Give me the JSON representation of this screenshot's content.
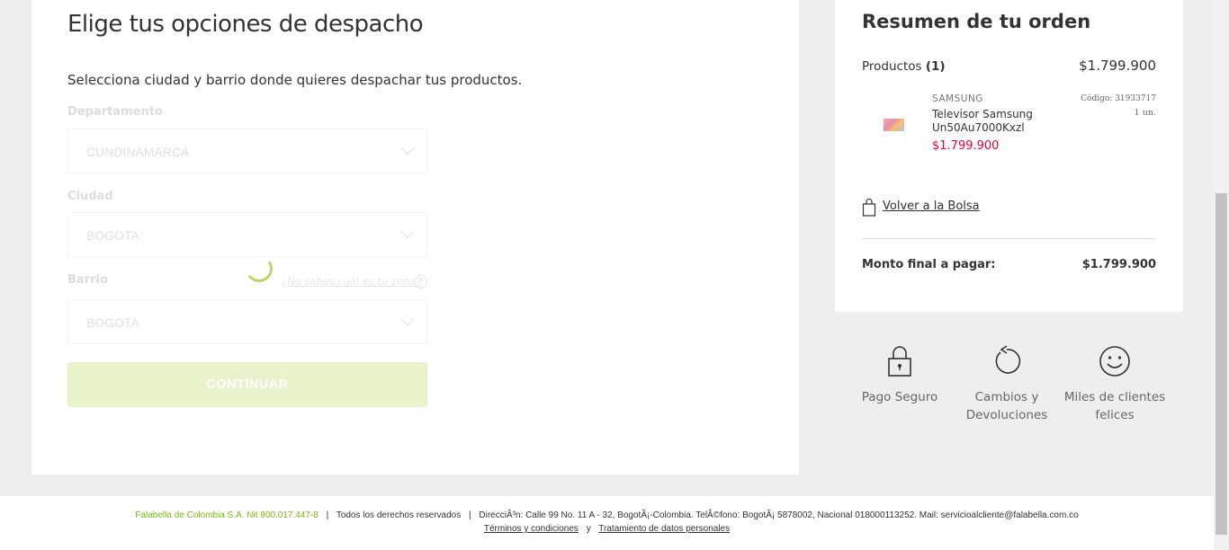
{
  "shipping": {
    "title": "Elige tus opciones de despacho",
    "instructions": "Selecciona ciudad y barrio donde quieres despachar tus productos.",
    "department_label": "Departamento",
    "department_value": "CUNDINAMARCA",
    "city_label": "Ciudad",
    "city_value": "BOGOTA",
    "neighborhood_label": "Barrio",
    "neighborhood_value": "BOGOTA",
    "help_link": "¿No sabes cuál es tu zona?",
    "help_icon_text": "?",
    "continue_label": "CONTINUAR"
  },
  "summary": {
    "title": "Resumen de tu orden",
    "products_label": "Productos",
    "products_count": "(1)",
    "products_total": "$1.799.900",
    "item": {
      "brand": "SAMSUNG",
      "name": "Televisor Samsung Un50Au7000Kxzl",
      "price": "$1.799.900",
      "code": "Código: 31933717",
      "quantity": "1 un."
    },
    "back_link": "Volver a la Bolsa",
    "final_label": "Monto final a pagar:",
    "final_value": "$1.799.900"
  },
  "benefits": [
    {
      "label": "Pago Seguro",
      "icon": "lock-icon"
    },
    {
      "label": "Cambios y Devoluciones",
      "icon": "refresh-icon"
    },
    {
      "label": "Miles de clientes felices",
      "icon": "smiley-icon"
    }
  ],
  "footer": {
    "company": "Falabella de Colombia S.A. Nit 900.017.447-8",
    "rights": "Todos los derechos reservados",
    "address": "DirecciÃ³n: Calle 99 No. 11 A - 32, BogotÃ¡-Colombia. TelÃ©fono: BogotÃ¡ 5878002, Nacional 018000113252. Mail: servicioalcliente@falabella.com.co",
    "separator": "|",
    "terms": "Términos y condiciones",
    "and": "y",
    "privacy": "Tratamiento de datos personales"
  },
  "colors": {
    "accent_green": "#7cb70f",
    "price_red": "#e3043f",
    "disabled_button": "#e9f3cb"
  }
}
